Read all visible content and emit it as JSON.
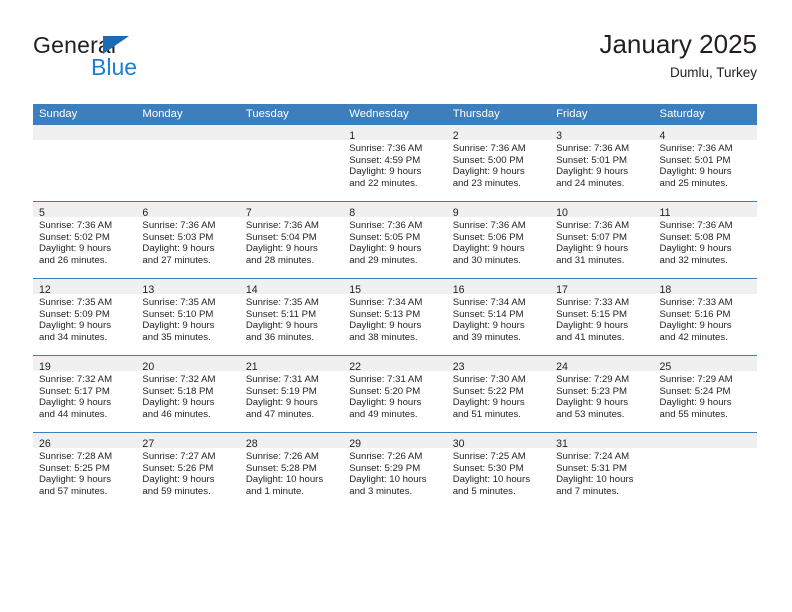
{
  "brand": {
    "name_top": "General",
    "name_bottom": "Blue",
    "triangle_icon": "brand-triangle-icon",
    "colors": {
      "blue_text": "#1b7fd4",
      "triangle": "#1b6cb0",
      "dark_text": "#231f20"
    }
  },
  "header": {
    "title": "January 2025",
    "subtitle": "Dumlu, Turkey"
  },
  "calendar": {
    "accent_color": "#3d7ebd",
    "band_color": "#f0f0f0",
    "weekday_headers": [
      "Sunday",
      "Monday",
      "Tuesday",
      "Wednesday",
      "Thursday",
      "Friday",
      "Saturday"
    ],
    "weeks": [
      [
        {
          "day": "",
          "lines": []
        },
        {
          "day": "",
          "lines": []
        },
        {
          "day": "",
          "lines": []
        },
        {
          "day": "1",
          "lines": [
            "Sunrise: 7:36 AM",
            "Sunset: 4:59 PM",
            "Daylight: 9 hours",
            "and 22 minutes."
          ]
        },
        {
          "day": "2",
          "lines": [
            "Sunrise: 7:36 AM",
            "Sunset: 5:00 PM",
            "Daylight: 9 hours",
            "and 23 minutes."
          ]
        },
        {
          "day": "3",
          "lines": [
            "Sunrise: 7:36 AM",
            "Sunset: 5:01 PM",
            "Daylight: 9 hours",
            "and 24 minutes."
          ]
        },
        {
          "day": "4",
          "lines": [
            "Sunrise: 7:36 AM",
            "Sunset: 5:01 PM",
            "Daylight: 9 hours",
            "and 25 minutes."
          ]
        }
      ],
      [
        {
          "day": "5",
          "lines": [
            "Sunrise: 7:36 AM",
            "Sunset: 5:02 PM",
            "Daylight: 9 hours",
            "and 26 minutes."
          ]
        },
        {
          "day": "6",
          "lines": [
            "Sunrise: 7:36 AM",
            "Sunset: 5:03 PM",
            "Daylight: 9 hours",
            "and 27 minutes."
          ]
        },
        {
          "day": "7",
          "lines": [
            "Sunrise: 7:36 AM",
            "Sunset: 5:04 PM",
            "Daylight: 9 hours",
            "and 28 minutes."
          ]
        },
        {
          "day": "8",
          "lines": [
            "Sunrise: 7:36 AM",
            "Sunset: 5:05 PM",
            "Daylight: 9 hours",
            "and 29 minutes."
          ]
        },
        {
          "day": "9",
          "lines": [
            "Sunrise: 7:36 AM",
            "Sunset: 5:06 PM",
            "Daylight: 9 hours",
            "and 30 minutes."
          ]
        },
        {
          "day": "10",
          "lines": [
            "Sunrise: 7:36 AM",
            "Sunset: 5:07 PM",
            "Daylight: 9 hours",
            "and 31 minutes."
          ]
        },
        {
          "day": "11",
          "lines": [
            "Sunrise: 7:36 AM",
            "Sunset: 5:08 PM",
            "Daylight: 9 hours",
            "and 32 minutes."
          ]
        }
      ],
      [
        {
          "day": "12",
          "lines": [
            "Sunrise: 7:35 AM",
            "Sunset: 5:09 PM",
            "Daylight: 9 hours",
            "and 34 minutes."
          ]
        },
        {
          "day": "13",
          "lines": [
            "Sunrise: 7:35 AM",
            "Sunset: 5:10 PM",
            "Daylight: 9 hours",
            "and 35 minutes."
          ]
        },
        {
          "day": "14",
          "lines": [
            "Sunrise: 7:35 AM",
            "Sunset: 5:11 PM",
            "Daylight: 9 hours",
            "and 36 minutes."
          ]
        },
        {
          "day": "15",
          "lines": [
            "Sunrise: 7:34 AM",
            "Sunset: 5:13 PM",
            "Daylight: 9 hours",
            "and 38 minutes."
          ]
        },
        {
          "day": "16",
          "lines": [
            "Sunrise: 7:34 AM",
            "Sunset: 5:14 PM",
            "Daylight: 9 hours",
            "and 39 minutes."
          ]
        },
        {
          "day": "17",
          "lines": [
            "Sunrise: 7:33 AM",
            "Sunset: 5:15 PM",
            "Daylight: 9 hours",
            "and 41 minutes."
          ]
        },
        {
          "day": "18",
          "lines": [
            "Sunrise: 7:33 AM",
            "Sunset: 5:16 PM",
            "Daylight: 9 hours",
            "and 42 minutes."
          ]
        }
      ],
      [
        {
          "day": "19",
          "lines": [
            "Sunrise: 7:32 AM",
            "Sunset: 5:17 PM",
            "Daylight: 9 hours",
            "and 44 minutes."
          ]
        },
        {
          "day": "20",
          "lines": [
            "Sunrise: 7:32 AM",
            "Sunset: 5:18 PM",
            "Daylight: 9 hours",
            "and 46 minutes."
          ]
        },
        {
          "day": "21",
          "lines": [
            "Sunrise: 7:31 AM",
            "Sunset: 5:19 PM",
            "Daylight: 9 hours",
            "and 47 minutes."
          ]
        },
        {
          "day": "22",
          "lines": [
            "Sunrise: 7:31 AM",
            "Sunset: 5:20 PM",
            "Daylight: 9 hours",
            "and 49 minutes."
          ]
        },
        {
          "day": "23",
          "lines": [
            "Sunrise: 7:30 AM",
            "Sunset: 5:22 PM",
            "Daylight: 9 hours",
            "and 51 minutes."
          ]
        },
        {
          "day": "24",
          "lines": [
            "Sunrise: 7:29 AM",
            "Sunset: 5:23 PM",
            "Daylight: 9 hours",
            "and 53 minutes."
          ]
        },
        {
          "day": "25",
          "lines": [
            "Sunrise: 7:29 AM",
            "Sunset: 5:24 PM",
            "Daylight: 9 hours",
            "and 55 minutes."
          ]
        }
      ],
      [
        {
          "day": "26",
          "lines": [
            "Sunrise: 7:28 AM",
            "Sunset: 5:25 PM",
            "Daylight: 9 hours",
            "and 57 minutes."
          ]
        },
        {
          "day": "27",
          "lines": [
            "Sunrise: 7:27 AM",
            "Sunset: 5:26 PM",
            "Daylight: 9 hours",
            "and 59 minutes."
          ]
        },
        {
          "day": "28",
          "lines": [
            "Sunrise: 7:26 AM",
            "Sunset: 5:28 PM",
            "Daylight: 10 hours",
            "and 1 minute."
          ]
        },
        {
          "day": "29",
          "lines": [
            "Sunrise: 7:26 AM",
            "Sunset: 5:29 PM",
            "Daylight: 10 hours",
            "and 3 minutes."
          ]
        },
        {
          "day": "30",
          "lines": [
            "Sunrise: 7:25 AM",
            "Sunset: 5:30 PM",
            "Daylight: 10 hours",
            "and 5 minutes."
          ]
        },
        {
          "day": "31",
          "lines": [
            "Sunrise: 7:24 AM",
            "Sunset: 5:31 PM",
            "Daylight: 10 hours",
            "and 7 minutes."
          ]
        },
        {
          "day": "",
          "lines": []
        }
      ]
    ]
  }
}
